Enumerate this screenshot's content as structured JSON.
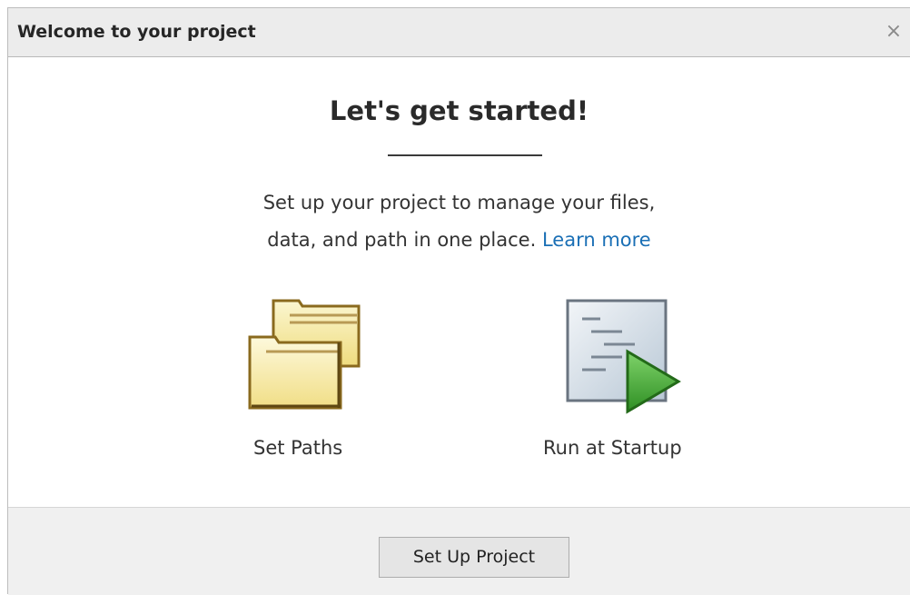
{
  "dialog": {
    "title": "Welcome to your project",
    "close_glyph": "×",
    "close_icon": "close-icon"
  },
  "main": {
    "heading": "Let's get started!",
    "description_line1": "Set up your project to manage your files,",
    "description_line2": "data, and path in one place.",
    "learn_more": "Learn more"
  },
  "actions": [
    {
      "label": "Set Paths",
      "icon": "folders-icon"
    },
    {
      "label": "Run at Startup",
      "icon": "run-script-icon"
    }
  ],
  "footer": {
    "setup_label": "Set Up Project"
  },
  "colors": {
    "link": "#1a6fb5",
    "folder": "#f5e9a6",
    "play": "#4caf3a"
  }
}
